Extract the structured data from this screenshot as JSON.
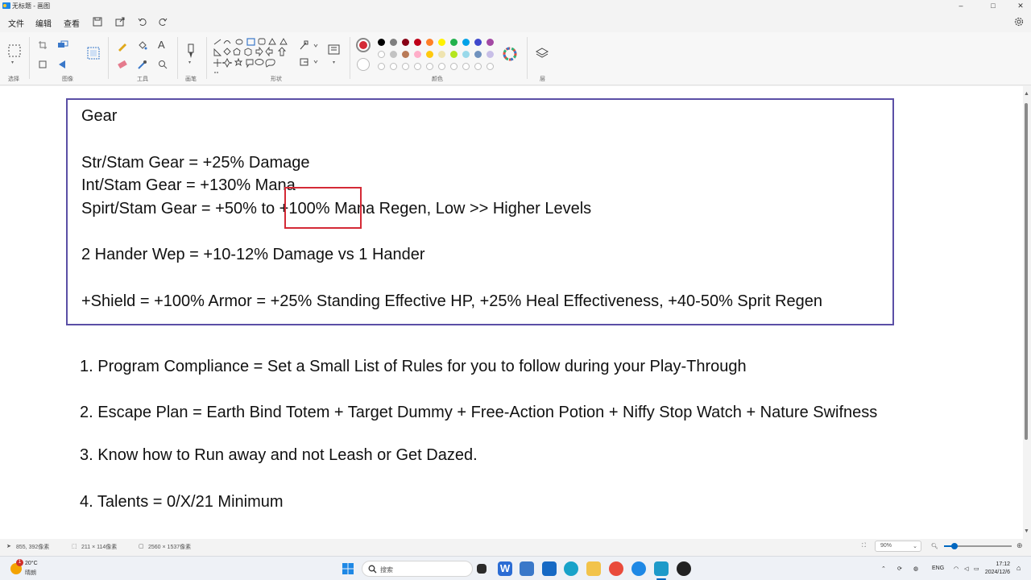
{
  "window": {
    "title": "无标题 - 画图",
    "minimize": "–",
    "maximize": "□",
    "close": "✕"
  },
  "menu": {
    "file": "文件",
    "edit": "编辑",
    "view": "查看"
  },
  "ribbon": {
    "groups": {
      "select": "选择",
      "image": "图像",
      "tools": "工具",
      "brushes": "画笔",
      "shapes": "形状",
      "colors": "颜色",
      "layers": "层"
    },
    "colors": {
      "current": "#d42a36",
      "row1": [
        "#000000",
        "#7f7f7f",
        "#880015",
        "#c00018",
        "#ff7f27",
        "#fff200",
        "#22b14c",
        "#00a2e8",
        "#3f48cc",
        "#a349a4"
      ],
      "row2": [
        "#ffffff",
        "#c3c3c3",
        "#b97a57",
        "#ffaec9",
        "#ffc90e",
        "#efe4b0",
        "#b5e61d",
        "#99d9ea",
        "#7092be",
        "#c8bfe7"
      ]
    }
  },
  "canvas": {
    "gear_title": "Gear",
    "gear_lines": [
      "Str/Stam Gear = +25% Damage",
      "Int/Stam Gear = +130% Mana",
      "Spirt/Stam Gear = +50% to +100% Mana Regen, Low >> Higher Levels",
      "2 Hander Wep = +10-12% Damage vs 1 Hander",
      "+Shield = +100% Armor = +25% Standing Effective HP, +25% Heal Effectiveness, +40-50% Sprit Regen"
    ],
    "rules": [
      "1. Program Compliance = Set a Small List of Rules for you to follow during your Play-Through",
      "2. Escape Plan = Earth Bind Totem + Target Dummy + Free-Action Potion + Niffy Stop Watch + Nature Swifness",
      "3. Know how to Run away and not Leash or Get Dazed.",
      "4. Talents = 0/X/21 Minimum"
    ]
  },
  "status": {
    "cursor_pos": "855, 392像素",
    "selection_size": "211 × 114像素",
    "canvas_size": "2560 × 1537像素",
    "zoom": "90%",
    "zoom_fraction": 0.15
  },
  "taskbar": {
    "weather_temp": "20°C",
    "weather_desc": "晴朗",
    "weather_badge": "1",
    "search_placeholder": "搜索",
    "lang": "ENG",
    "time": "17:12",
    "date": "2024/12/6"
  }
}
